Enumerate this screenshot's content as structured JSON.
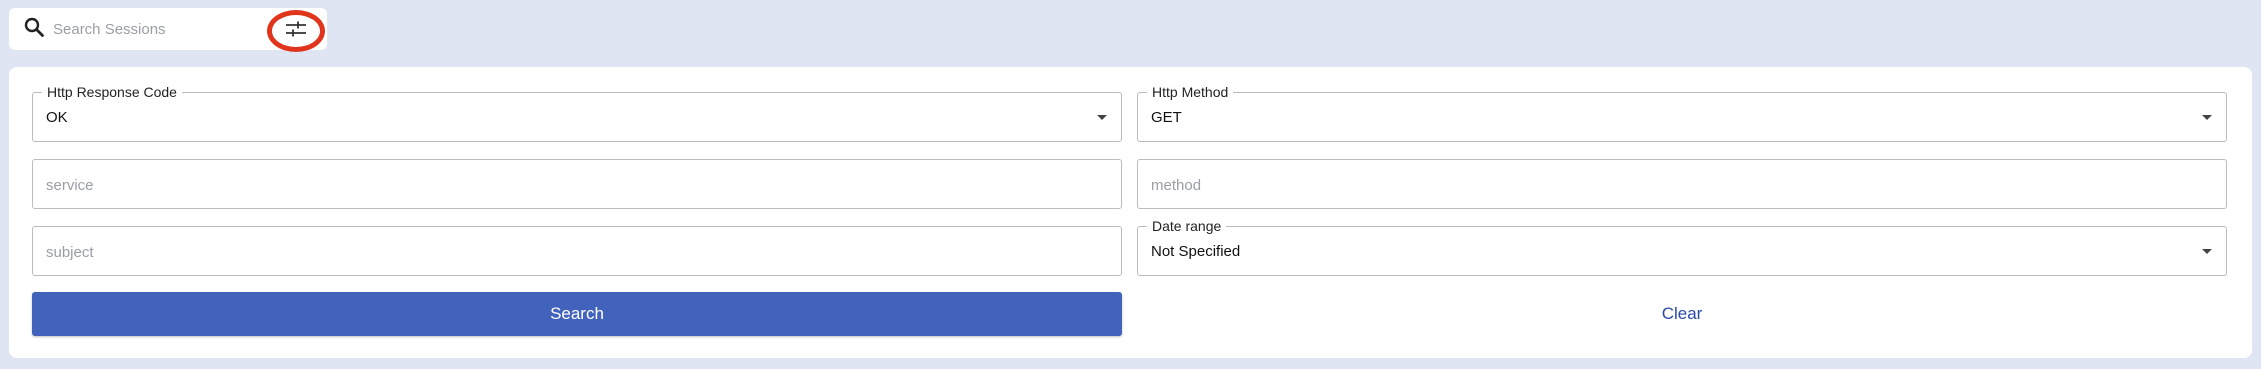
{
  "search": {
    "placeholder": "Search Sessions",
    "icon": "search-icon",
    "filter_icon": "sliders-icon",
    "filter_highlight_color": "#e0351c"
  },
  "filters": {
    "http_response_code": {
      "label": "Http Response Code",
      "value": "OK"
    },
    "http_method": {
      "label": "Http Method",
      "value": "GET"
    },
    "service": {
      "placeholder": "service"
    },
    "method": {
      "placeholder": "method"
    },
    "subject": {
      "placeholder": "subject"
    },
    "date_range": {
      "label": "Date range",
      "value": "Not Specified"
    }
  },
  "actions": {
    "search_label": "Search",
    "clear_label": "Clear"
  },
  "colors": {
    "background": "#dfe5f3",
    "primary": "#4263bb",
    "link": "#2a4aa8"
  }
}
